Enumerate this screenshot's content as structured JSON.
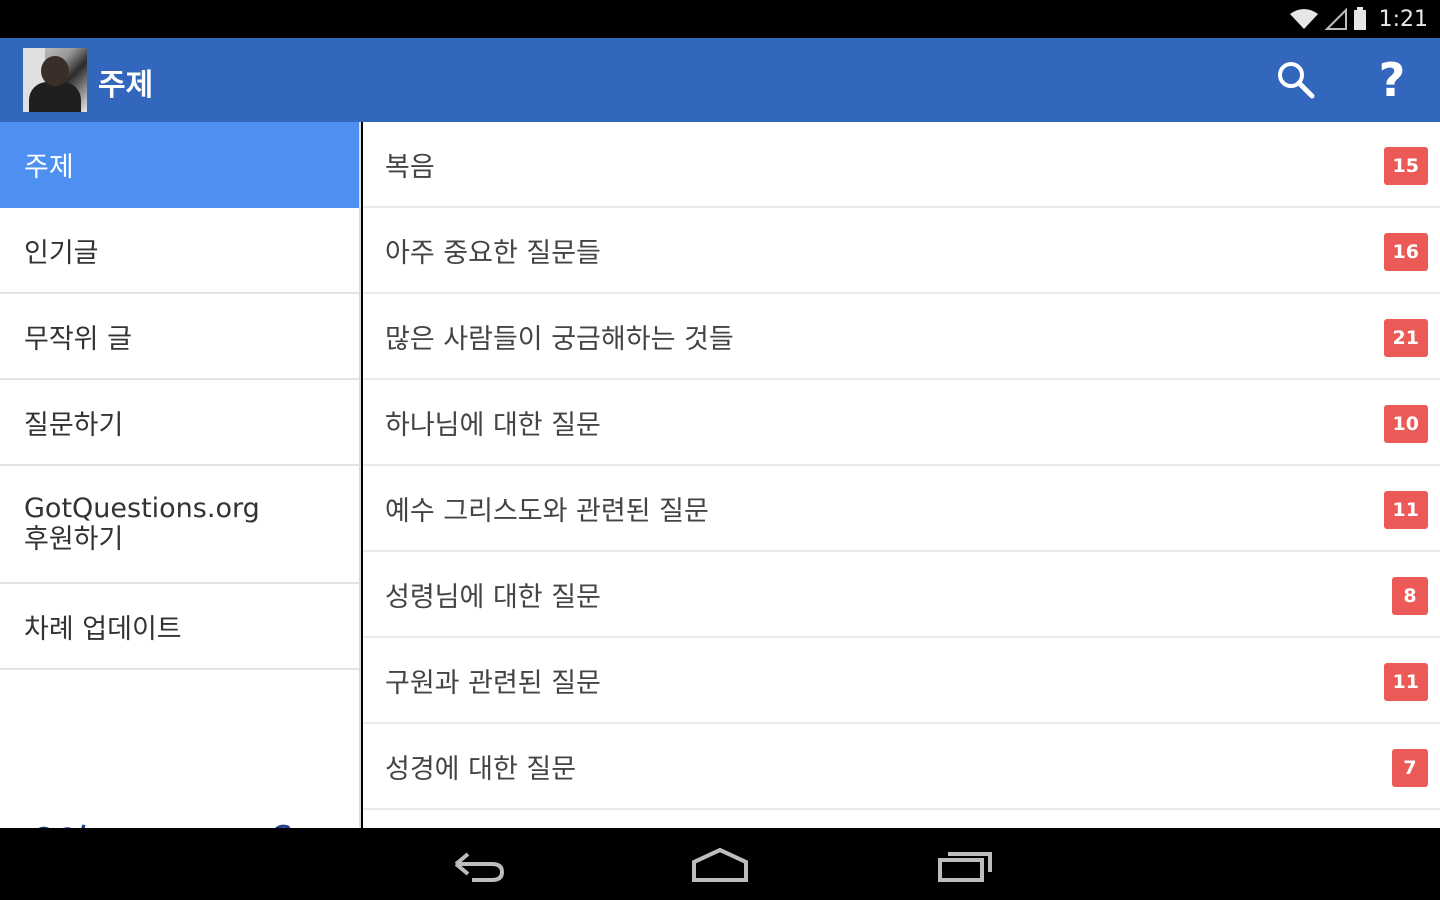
{
  "status": {
    "time": "1:21"
  },
  "actionbar": {
    "title": "주제"
  },
  "sidebar": {
    "items": [
      {
        "label": "주제",
        "active": true
      },
      {
        "label": "인기글",
        "active": false
      },
      {
        "label": "무작위 글",
        "active": false
      },
      {
        "label": "질문하기",
        "active": false
      },
      {
        "label_line1": "GotQuestions.org",
        "label_line2": "후원하기",
        "active": false
      },
      {
        "label": "차례 업데이트",
        "active": false
      }
    ]
  },
  "topics": [
    {
      "label": "복음",
      "count": "15"
    },
    {
      "label": "아주 중요한 질문들",
      "count": "16"
    },
    {
      "label": "많은 사람들이 궁금해하는 것들",
      "count": "21"
    },
    {
      "label": "하나님에 대한 질문",
      "count": "10"
    },
    {
      "label": "예수 그리스도와 관련된 질문",
      "count": "11"
    },
    {
      "label": "성령님에 대한 질문",
      "count": "8"
    },
    {
      "label": "구원과 관련된 질문",
      "count": "11"
    },
    {
      "label": "성경에 대한 질문",
      "count": "7"
    }
  ],
  "colors": {
    "actionbar": "#3366bd",
    "active_nav": "#4e8ff2",
    "badge": "#ec5a57"
  }
}
